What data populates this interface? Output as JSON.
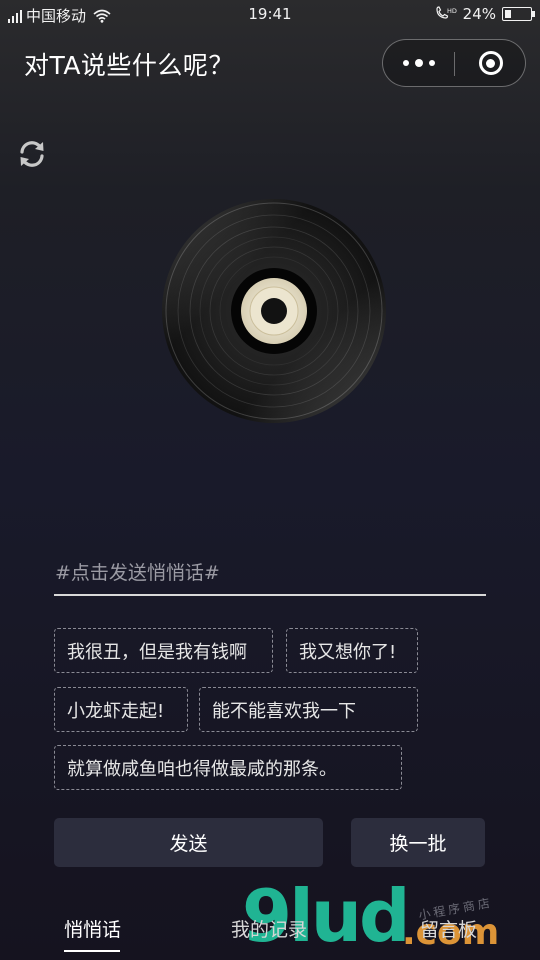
{
  "status_bar": {
    "carrier": "中国移动",
    "time": "19:41",
    "call_hd": "HD",
    "battery": "24%",
    "battery_level": 0.24,
    "icons": [
      "signal-icon",
      "wifi-icon",
      "call-hd-icon",
      "battery-icon"
    ]
  },
  "nav": {
    "title": "对TA说些什么呢？",
    "capsule_icons": [
      "more-dots-icon",
      "close-target-icon"
    ]
  },
  "toolbar": {
    "refresh_icon": "refresh-icon"
  },
  "player": {
    "icon": "vinyl-record-icon"
  },
  "input": {
    "placeholder": "#点击发送悄悄话#",
    "value": ""
  },
  "suggestions": [
    "我很丑，但是我有钱啊",
    "我又想你了!",
    "小龙虾走起!",
    "能不能喜欢我一下",
    "就算做咸鱼咱也得做最咸的那条。"
  ],
  "actions": {
    "send": "发送",
    "shuffle": "换一批"
  },
  "tabs": [
    {
      "label": "悄悄话",
      "active": true
    },
    {
      "label": "我的记录",
      "active": false
    },
    {
      "label": "留言板",
      "active": false
    }
  ],
  "watermark": {
    "brand": "9lud",
    "tld": ".com",
    "sub": "小程序商店"
  },
  "colors": {
    "background_top": "#2b2b2d",
    "background_bottom": "#15131f",
    "button_bg": "#2c2d3d",
    "chip_border": "#8a8a94",
    "watermark_green": "#22c6a0",
    "watermark_orange": "#f2a33a"
  }
}
